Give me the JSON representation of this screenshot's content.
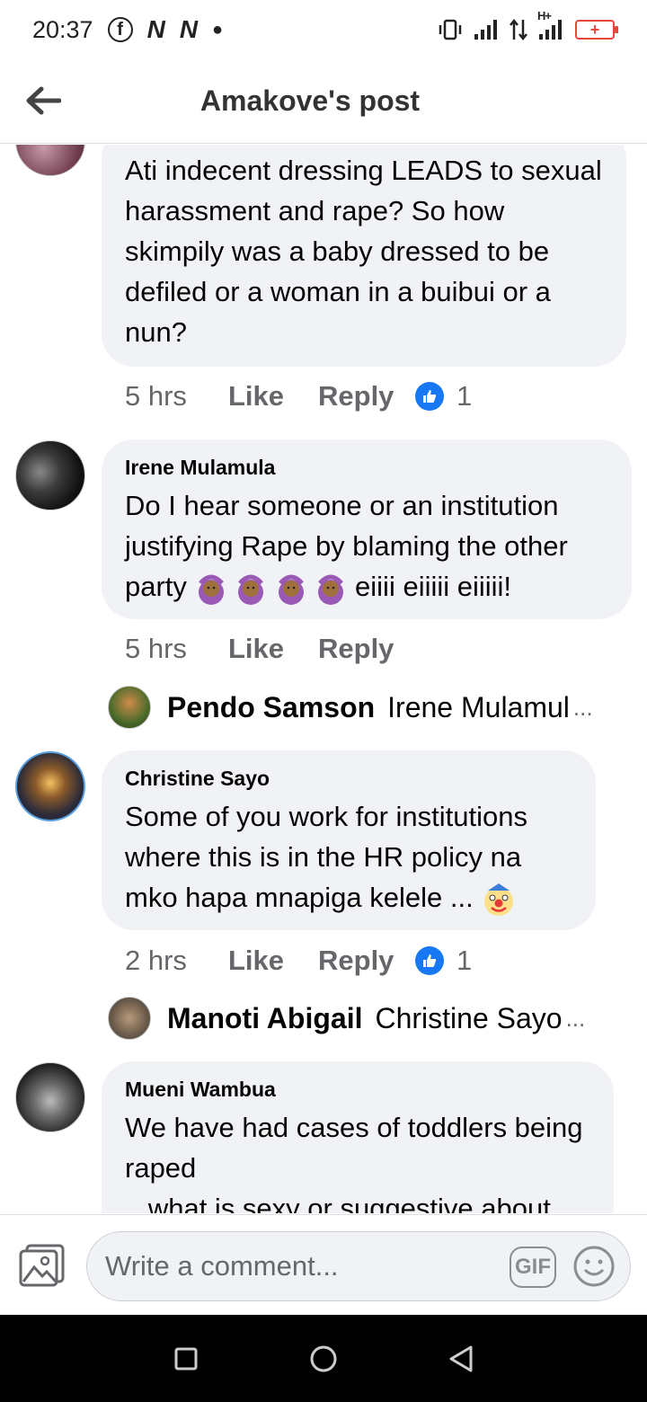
{
  "status_bar": {
    "time": "20:37",
    "network": "H+",
    "battery_symbol": "+"
  },
  "header": {
    "title": "Amakove's post"
  },
  "comments": [
    {
      "text": "Ati indecent dressing LEADS to sexual harassment and rape? So how skimpily was a baby dressed to be defiled or a woman in a buibui or a nun?",
      "time": "5 hrs",
      "like": "Like",
      "reply": "Reply",
      "reactions": "1"
    },
    {
      "name": "Irene Mulamula",
      "text": "Do I hear someone or an institution justifying Rape by blaming the other party",
      "text_tail": "eiiii eiiiii eiiiii!",
      "time": "5 hrs",
      "like": "Like",
      "reply": "Reply",
      "reply_preview": {
        "author": "Pendo Samson",
        "snippet": "Irene Mulamul",
        "more": "..."
      }
    },
    {
      "name": "Christine Sayo",
      "text": "Some of you work for institutions where this is in the HR policy na mko hapa mnapiga kelele ...",
      "time": "2 hrs",
      "like": "Like",
      "reply": "Reply",
      "reactions": "1",
      "reply_preview": {
        "author": "Manoti Abigail",
        "snippet": "Christine Sayo",
        "more": "..."
      }
    },
    {
      "name": "Mueni Wambua",
      "text": "We have had cases of toddlers being raped",
      "text_partial": "...what is sexy or suggestive about"
    }
  ],
  "composer": {
    "placeholder": "Write a comment...",
    "gif_label": "GIF"
  },
  "colors": {
    "accent": "#1877f2",
    "bubble": "#f0f2f5",
    "meta_text": "#65676b"
  }
}
